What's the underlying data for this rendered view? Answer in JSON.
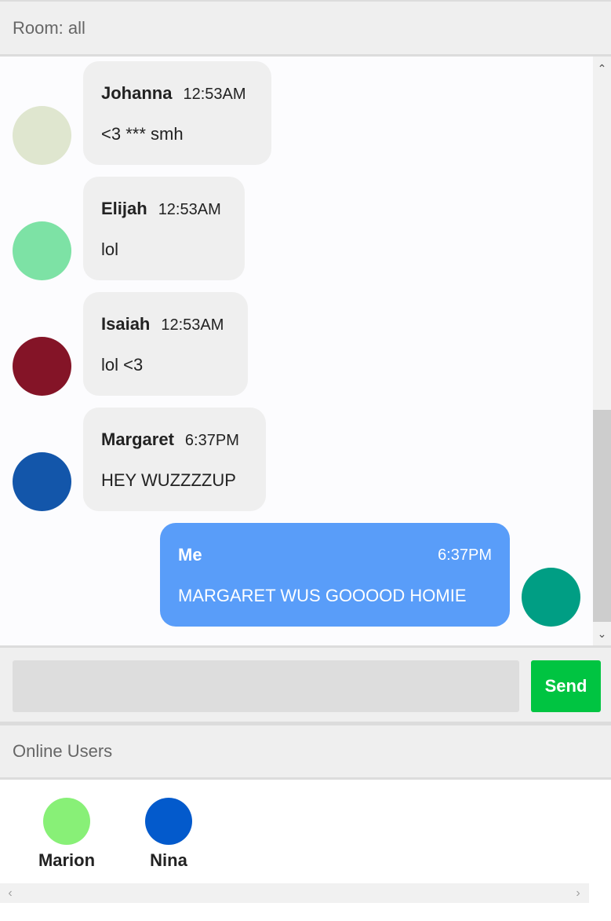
{
  "room": {
    "label": "Room: all"
  },
  "messages": [
    {
      "sender": "Johanna",
      "time": "12:53AM",
      "text": "<3 *** smh",
      "avatar_color": "#dfe6cf",
      "mine": false
    },
    {
      "sender": "Elijah",
      "time": "12:53AM",
      "text": "lol",
      "avatar_color": "#7de2a5",
      "mine": false
    },
    {
      "sender": "Isaiah",
      "time": "12:53AM",
      "text": "lol <3",
      "avatar_color": "#841427",
      "mine": false
    },
    {
      "sender": "Margaret",
      "time": "6:37PM",
      "text": "HEY WUZZZZUP",
      "avatar_color": "#1356aa",
      "mine": false
    },
    {
      "sender": "Me",
      "time": "6:37PM",
      "text": "MARGARET WUS GOOOOD HOMIE",
      "avatar_color": "#009e84",
      "mine": true
    }
  ],
  "composer": {
    "input_value": "",
    "placeholder": "",
    "send_label": "Send",
    "send_color": "#00c441"
  },
  "online": {
    "title": "Online Users",
    "users": [
      {
        "name": "Marion",
        "avatar_color": "#88f077"
      },
      {
        "name": "Nina",
        "avatar_color": "#035acc"
      }
    ]
  },
  "icons": {
    "scroll_up": "chevron-up-icon",
    "scroll_down": "chevron-down-icon",
    "scroll_left": "chevron-left-icon",
    "scroll_right": "chevron-right-icon"
  },
  "colors": {
    "my_bubble": "#599df9",
    "other_bubble": "#efefef"
  }
}
